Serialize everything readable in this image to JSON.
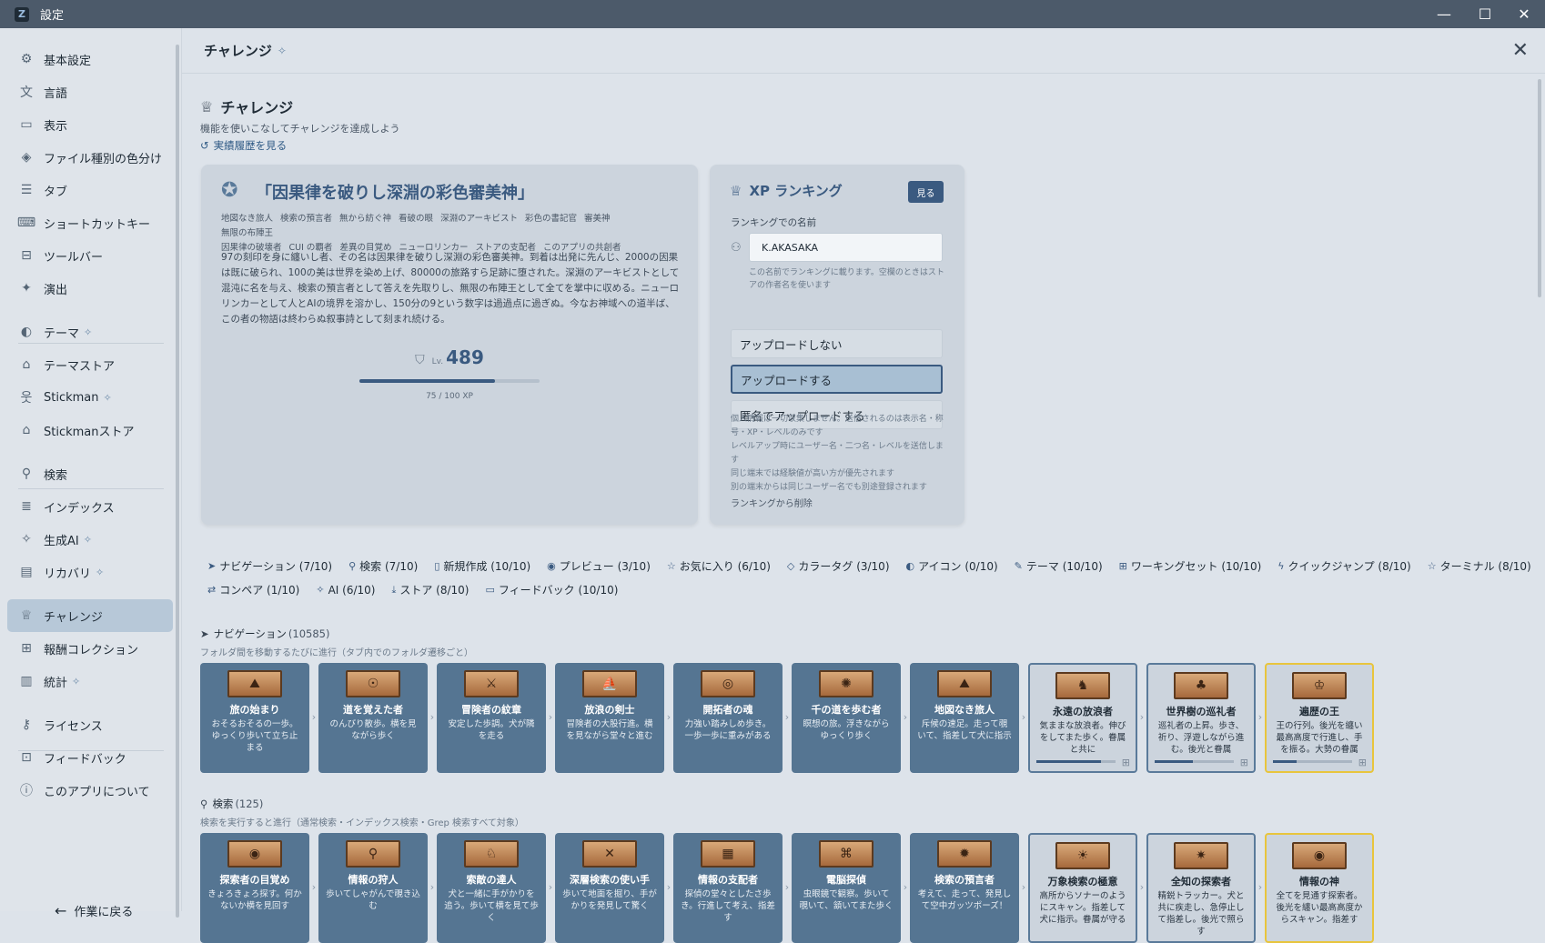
{
  "window": {
    "title": "設定"
  },
  "sidebar": {
    "items": [
      {
        "label": "基本設定",
        "icon": "gear-icon",
        "glyph": "⚙",
        "spark": false
      },
      {
        "label": "言語",
        "icon": "translate-icon",
        "glyph": "文",
        "spark": false
      },
      {
        "label": "表示",
        "icon": "monitor-icon",
        "glyph": "▭",
        "spark": false
      },
      {
        "label": "ファイル種別の色分け",
        "icon": "paint-bucket-icon",
        "glyph": "◈",
        "spark": false
      },
      {
        "label": "タブ",
        "icon": "tabs-list-icon",
        "glyph": "☰",
        "spark": false
      },
      {
        "label": "ショートカットキー",
        "icon": "keyboard-icon",
        "glyph": "⌨",
        "spark": false
      },
      {
        "label": "ツールバー",
        "icon": "toolbar-icon",
        "glyph": "⊟",
        "spark": false
      },
      {
        "label": "演出",
        "icon": "sparkle-icon",
        "glyph": "✦",
        "spark": false
      },
      {
        "label": "テーマ",
        "icon": "palette-icon",
        "glyph": "◐",
        "spark": true
      },
      {
        "label": "テーマストア",
        "icon": "store-icon",
        "glyph": "⌂",
        "spark": false
      },
      {
        "label": "Stickman",
        "icon": "stickman-icon",
        "glyph": "웃",
        "spark": true
      },
      {
        "label": "Stickmanストア",
        "icon": "store-icon",
        "glyph": "⌂",
        "spark": false
      },
      {
        "label": "検索",
        "icon": "search-icon",
        "glyph": "⚲",
        "spark": false
      },
      {
        "label": "インデックス",
        "icon": "database-icon",
        "glyph": "≣",
        "spark": false
      },
      {
        "label": "生成AI",
        "icon": "ai-sparkle-icon",
        "glyph": "✧",
        "spark": true
      },
      {
        "label": "リカバリ",
        "icon": "archive-icon",
        "glyph": "▤",
        "spark": true
      },
      {
        "label": "チャレンジ",
        "icon": "trophy-icon",
        "glyph": "♕",
        "spark": false,
        "active": true
      },
      {
        "label": "報酬コレクション",
        "icon": "gift-icon",
        "glyph": "⊞",
        "spark": false
      },
      {
        "label": "統計",
        "icon": "bar-chart-icon",
        "glyph": "▥",
        "spark": true
      },
      {
        "label": "ライセンス",
        "icon": "key-icon",
        "glyph": "⚷",
        "spark": false
      },
      {
        "label": "フィードバック",
        "icon": "feedback-icon",
        "glyph": "⊡",
        "spark": false
      },
      {
        "label": "このアプリについて",
        "icon": "info-icon",
        "glyph": "ⓘ",
        "spark": false
      }
    ],
    "back_label": "作業に戻る"
  },
  "header": {
    "title": "チャレンジ"
  },
  "challenge": {
    "title": "チャレンジ",
    "desc": "機能を使いこなしてチャレンジを達成しよう",
    "history_link": "実績履歴を見る"
  },
  "title_card": {
    "title": "「因果律を破りし深淵の彩色審美神」",
    "badges": [
      "地図なき旅人",
      "検索の預言者",
      "無から紡ぐ神",
      "看破の眼",
      "深淵のアーキビスト",
      "彩色の書記官",
      "審美神",
      "無限の布陣王",
      "因果律の破壊者",
      "CUI の覇者",
      "差異の目覚め",
      "ニューロリンカー",
      "ストアの支配者",
      "このアプリの共創者"
    ],
    "story": "97の刻印を身に纏いし者、その名は因果律を破りし深淵の彩色審美神。到着は出発に先んじ、2000の因果は既に破られ、100の美は世界を染め上げ、80000の旅路すら足跡に堕された。深淵のアーキビストとして混沌に名を与え、検索の預言者として答えを先取りし、無限の布陣王として全てを掌中に収める。ニューロリンカーとして人とAIの境界を溶かし、150分の9という数字は過過点に過ぎぬ。今なお神域への道半ば、この者の物語は終わらぬ叙事詩として刻まれ続ける。",
    "level_label": "Lv.",
    "level": "489",
    "xp_text": "75 / 100 XP",
    "xp_fraction": 0.75
  },
  "ranking": {
    "title": "XP ランキング",
    "see_button": "見る",
    "name_label": "ランキングでの名前",
    "name_value": "K.AKASAKA",
    "name_hint": "この名前でランキングに載ります。空欄のときはストアの作者名を使います",
    "options": [
      "アップロードしない",
      "アップロードする",
      "匿名でアップロードする"
    ],
    "selected": 1,
    "notes": [
      "個人情報は一切収集しません。送信されるのは表示名・称号・XP・レベルのみです",
      "レベルアップ時にユーザー名・二つ名・レベルを送信します",
      "同じ端末では経験値が高い方が優先されます",
      "別の端末からは同じユーザー名でも別途登録されます"
    ],
    "delete_link": "ランキングから削除"
  },
  "filters": {
    "row1": [
      {
        "label": "ナビゲーション (7/10)",
        "icon": "navigation-icon",
        "glyph": "➤"
      },
      {
        "label": "検索 (7/10)",
        "icon": "search-icon",
        "glyph": "⚲"
      },
      {
        "label": "新規作成 (10/10)",
        "icon": "new-file-icon",
        "glyph": "▯"
      },
      {
        "label": "プレビュー (3/10)",
        "icon": "eye-icon",
        "glyph": "◉"
      },
      {
        "label": "お気に入り (6/10)",
        "icon": "star-icon",
        "glyph": "☆"
      },
      {
        "label": "カラータグ (3/10)",
        "icon": "tag-icon",
        "glyph": "◇"
      },
      {
        "label": "アイコン (0/10)",
        "icon": "palette-icon",
        "glyph": "◐"
      },
      {
        "label": "テーマ (10/10)",
        "icon": "brush-icon",
        "glyph": "✎"
      },
      {
        "label": "ワーキングセット (10/10)",
        "icon": "grid-icon",
        "glyph": "⊞"
      },
      {
        "label": "クイックジャンプ (8/10)",
        "icon": "bolt-icon",
        "glyph": "ϟ"
      },
      {
        "label": "ターミナル (8/10)",
        "icon": "star-icon",
        "glyph": "☆"
      }
    ],
    "row2": [
      {
        "label": "コンペア (1/10)",
        "icon": "compare-icon",
        "glyph": "⇄"
      },
      {
        "label": "AI (6/10)",
        "icon": "ai-sparkle-icon",
        "glyph": "✧"
      },
      {
        "label": "ストア (8/10)",
        "icon": "download-icon",
        "glyph": "⤓"
      },
      {
        "label": "フィードバック (10/10)",
        "icon": "feedback-icon",
        "glyph": "▭"
      }
    ]
  },
  "groups": [
    {
      "title": "ナビゲーション",
      "count": "(10585)",
      "icon": "navigation-icon",
      "glyph": "➤",
      "desc": "フォルダ間を移動するたびに進行（タブ内でのフォルダ遷移ごと）",
      "badges": [
        {
          "name": "旅の始まり",
          "desc": "おそるおそるの一歩。ゆっくり歩いて立ち止まる",
          "state": "unlocked",
          "art": "⛰"
        },
        {
          "name": "道を覚えた者",
          "desc": "のんびり散歩。横を見ながら歩く",
          "state": "unlocked",
          "art": "☉"
        },
        {
          "name": "冒険者の紋章",
          "desc": "安定した歩調。犬が隣を走る",
          "state": "unlocked",
          "art": "⚔"
        },
        {
          "name": "放浪の剣士",
          "desc": "冒険者の大股行進。横を見ながら堂々と進む",
          "state": "unlocked",
          "art": "⛵"
        },
        {
          "name": "開拓者の魂",
          "desc": "力強い踏みしめ歩き。一歩一歩に重みがある",
          "state": "unlocked",
          "art": "◎"
        },
        {
          "name": "千の道を歩む者",
          "desc": "瞑想の旅。浮きながらゆっくり歩く",
          "state": "unlocked",
          "art": "✺"
        },
        {
          "name": "地図なき旅人",
          "desc": "斥候の速足。走って覗いて、指差して犬に指示",
          "state": "unlocked",
          "art": "⛰"
        },
        {
          "name": "永遠の放浪者",
          "desc": "気ままな放浪者。伸びをしてまた歩く。眷属と共に",
          "state": "locked",
          "art": "♞",
          "progress": 0.82
        },
        {
          "name": "世界樹の巡礼者",
          "desc": "巡礼者の上昇。歩き、祈り、浮遊しながら進む。後光と眷属",
          "state": "locked",
          "art": "♣",
          "progress": 0.48
        },
        {
          "name": "遍歴の王",
          "desc": "王の行列。後光を纏い最高高度で行進し、手を振る。大勢の眷属",
          "state": "gold",
          "art": "♔",
          "progress": 0.3
        }
      ]
    },
    {
      "title": "検索",
      "count": "(125)",
      "icon": "search-icon",
      "glyph": "⚲",
      "desc": "検索を実行すると進行（通常検索・インデックス検索・Grep 検索すべて対象）",
      "badges": [
        {
          "name": "探索者の目覚め",
          "desc": "きょろきょろ探す。何かないか横を見回す",
          "state": "unlocked",
          "art": "◉"
        },
        {
          "name": "情報の狩人",
          "desc": "歩いてしゃがんで覗き込む",
          "state": "unlocked",
          "art": "⚲"
        },
        {
          "name": "索敵の達人",
          "desc": "犬と一緒に手がかりを追う。歩いて横を見て歩く",
          "state": "unlocked",
          "art": "♘"
        },
        {
          "name": "深層検索の使い手",
          "desc": "歩いて地面を掘り、手がかりを発見して驚く",
          "state": "unlocked",
          "art": "✕"
        },
        {
          "name": "情報の支配者",
          "desc": "探偵の堂々としたさ歩き。行進して考え、指差す",
          "state": "unlocked",
          "art": "▦"
        },
        {
          "name": "電脳探偵",
          "desc": "虫眼鏡で観察。歩いて覗いて、頷いてまた歩く",
          "state": "unlocked",
          "art": "⌘"
        },
        {
          "name": "検索の預言者",
          "desc": "考えて、走って、発見して空中ガッツポーズ！",
          "state": "unlocked",
          "art": "✹"
        },
        {
          "name": "万象検索の極意",
          "desc": "高所からソナーのようにスキャン。指差して犬に指示。眷属が守る",
          "state": "locked",
          "art": "☀"
        },
        {
          "name": "全知の探索者",
          "desc": "精鋭トラッカー。犬と共に疾走し、急停止して指差し。後光で照らす",
          "state": "locked",
          "art": "✷"
        },
        {
          "name": "情報の神",
          "desc": "全てを見通す探索者。後光を纏い最高高度からスキャン。指差す",
          "state": "gold",
          "art": "◉"
        }
      ]
    }
  ]
}
